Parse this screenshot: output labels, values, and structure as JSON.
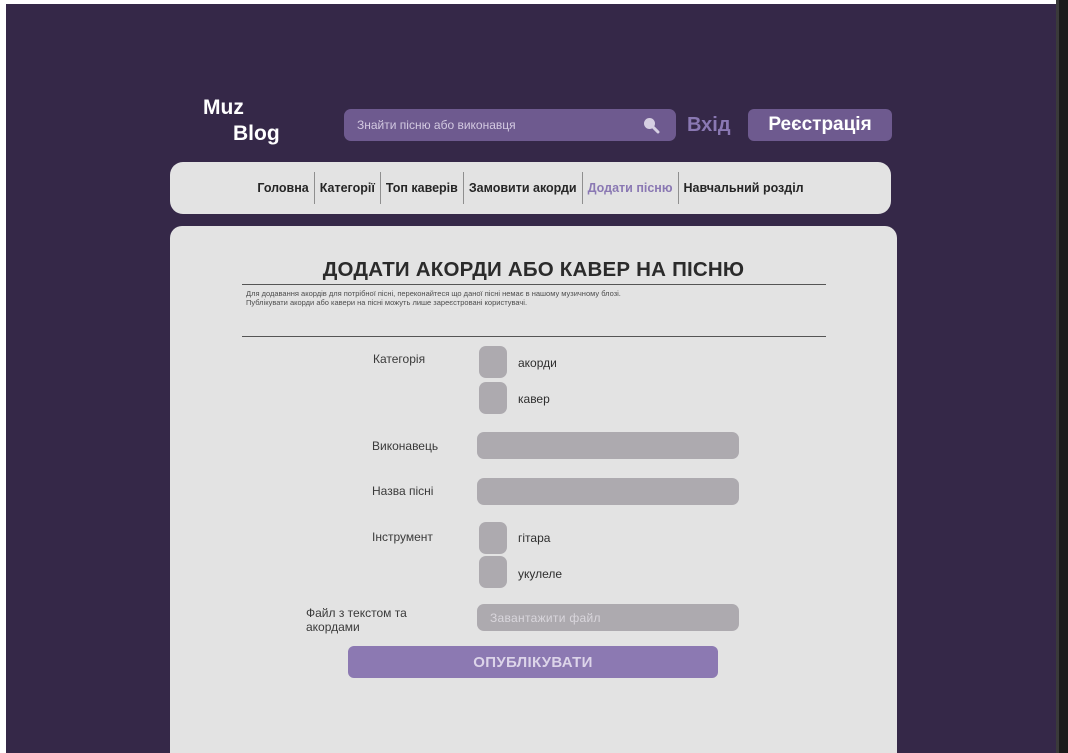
{
  "header": {
    "logo_line1": "Muz",
    "logo_line2": "Blog",
    "search_placeholder": "Знайти пісню або виконавця",
    "login_label": "Вхід",
    "register_label": "Реєстрація"
  },
  "nav": {
    "items": [
      {
        "label": "Головна"
      },
      {
        "label": "Категорії"
      },
      {
        "label": "Топ каверів"
      },
      {
        "label": "Замовити акорди"
      },
      {
        "label": "Додати пісню",
        "active": true
      },
      {
        "label": "Навчальний розділ"
      }
    ]
  },
  "form": {
    "title": "ДОДАТИ АКОРДИ АБО КАВЕР НА ПІСНЮ",
    "intro_line1": "Для додавання акордів для потрібної пісні, переконайтеся що даної пісні немає в нашому музичному блозі.",
    "intro_line2": "Публікувати акорди або кавери на пісні можуть лише зареєстровані користувачі.",
    "category_label": "Категорія",
    "category_options": [
      "акорди",
      "кавер"
    ],
    "artist_label": "Виконавець",
    "artist_value": "",
    "song_label": "Назва пісні",
    "song_value": "",
    "instrument_label": "Інструмент",
    "instrument_options": [
      "гітара",
      "укулеле"
    ],
    "file_label": "Файл з текстом та акордами",
    "file_placeholder": "Завантажити  файл",
    "publish_label": "ОПУБЛІКУВАТИ"
  },
  "colors": {
    "background": "#352848",
    "accent": "#6e5a8f",
    "accent_light": "#8c79b2",
    "panel": "#e3e3e3",
    "field": "#adaaaf"
  }
}
